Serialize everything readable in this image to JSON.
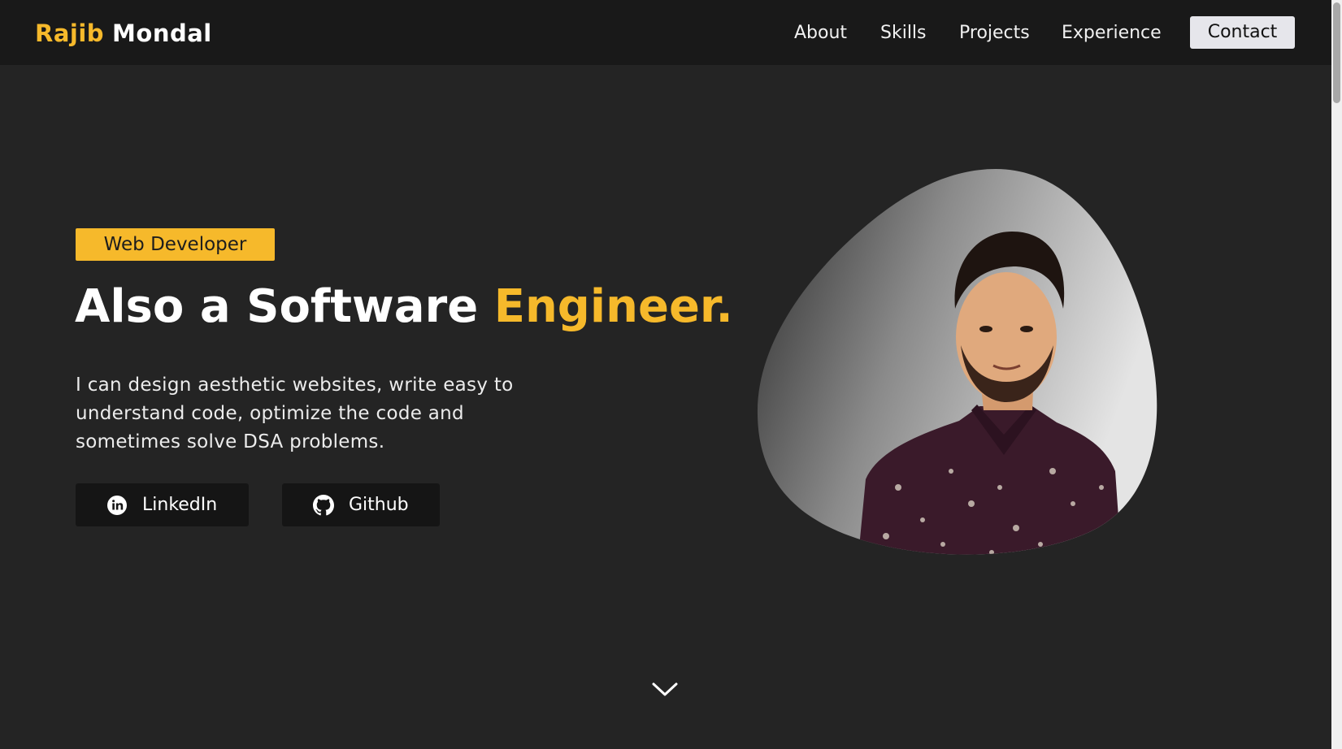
{
  "nav": {
    "brand_first": "Rajib",
    "brand_last": "Mondal",
    "links": [
      "About",
      "Skills",
      "Projects",
      "Experience"
    ],
    "contact_label": "Contact"
  },
  "hero": {
    "role_badge": "Web Developer",
    "headline_main": "Also a Software ",
    "headline_accent": "Engineer.",
    "intro": "I can design aesthetic websites, write easy to understand code, optimize the code and sometimes solve DSA problems.",
    "buttons": {
      "linkedin": "LinkedIn",
      "github": "Github"
    }
  },
  "icons": {
    "linkedin": "linkedin-icon",
    "github": "github-icon",
    "scroll": "chevron-down-icon"
  },
  "colors": {
    "accent": "#f6b92b",
    "background": "#242424",
    "navbar": "#191919",
    "button_dark": "#151515",
    "contact_button": "#e6e6eb"
  }
}
